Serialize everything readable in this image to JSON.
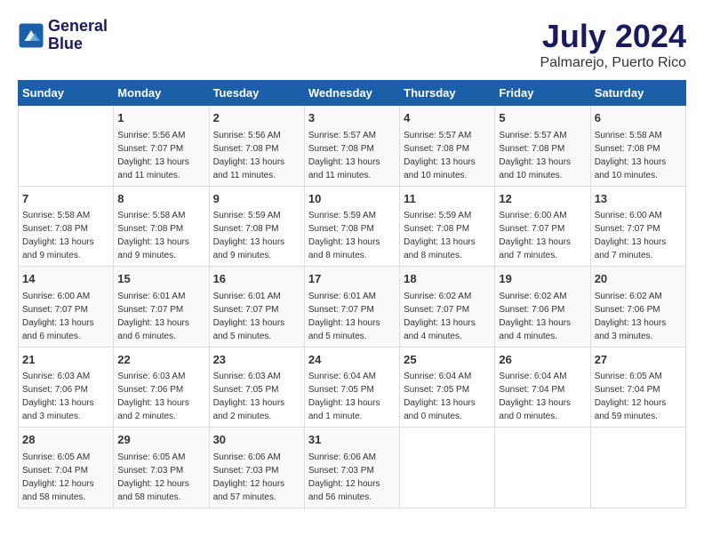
{
  "header": {
    "logo_line1": "General",
    "logo_line2": "Blue",
    "title": "July 2024",
    "subtitle": "Palmarejo, Puerto Rico"
  },
  "days_of_week": [
    "Sunday",
    "Monday",
    "Tuesday",
    "Wednesday",
    "Thursday",
    "Friday",
    "Saturday"
  ],
  "weeks": [
    [
      {
        "day": "",
        "info": ""
      },
      {
        "day": "1",
        "info": "Sunrise: 5:56 AM\nSunset: 7:07 PM\nDaylight: 13 hours\nand 11 minutes."
      },
      {
        "day": "2",
        "info": "Sunrise: 5:56 AM\nSunset: 7:08 PM\nDaylight: 13 hours\nand 11 minutes."
      },
      {
        "day": "3",
        "info": "Sunrise: 5:57 AM\nSunset: 7:08 PM\nDaylight: 13 hours\nand 11 minutes."
      },
      {
        "day": "4",
        "info": "Sunrise: 5:57 AM\nSunset: 7:08 PM\nDaylight: 13 hours\nand 10 minutes."
      },
      {
        "day": "5",
        "info": "Sunrise: 5:57 AM\nSunset: 7:08 PM\nDaylight: 13 hours\nand 10 minutes."
      },
      {
        "day": "6",
        "info": "Sunrise: 5:58 AM\nSunset: 7:08 PM\nDaylight: 13 hours\nand 10 minutes."
      }
    ],
    [
      {
        "day": "7",
        "info": "Sunrise: 5:58 AM\nSunset: 7:08 PM\nDaylight: 13 hours\nand 9 minutes."
      },
      {
        "day": "8",
        "info": "Sunrise: 5:58 AM\nSunset: 7:08 PM\nDaylight: 13 hours\nand 9 minutes."
      },
      {
        "day": "9",
        "info": "Sunrise: 5:59 AM\nSunset: 7:08 PM\nDaylight: 13 hours\nand 9 minutes."
      },
      {
        "day": "10",
        "info": "Sunrise: 5:59 AM\nSunset: 7:08 PM\nDaylight: 13 hours\nand 8 minutes."
      },
      {
        "day": "11",
        "info": "Sunrise: 5:59 AM\nSunset: 7:08 PM\nDaylight: 13 hours\nand 8 minutes."
      },
      {
        "day": "12",
        "info": "Sunrise: 6:00 AM\nSunset: 7:07 PM\nDaylight: 13 hours\nand 7 minutes."
      },
      {
        "day": "13",
        "info": "Sunrise: 6:00 AM\nSunset: 7:07 PM\nDaylight: 13 hours\nand 7 minutes."
      }
    ],
    [
      {
        "day": "14",
        "info": "Sunrise: 6:00 AM\nSunset: 7:07 PM\nDaylight: 13 hours\nand 6 minutes."
      },
      {
        "day": "15",
        "info": "Sunrise: 6:01 AM\nSunset: 7:07 PM\nDaylight: 13 hours\nand 6 minutes."
      },
      {
        "day": "16",
        "info": "Sunrise: 6:01 AM\nSunset: 7:07 PM\nDaylight: 13 hours\nand 5 minutes."
      },
      {
        "day": "17",
        "info": "Sunrise: 6:01 AM\nSunset: 7:07 PM\nDaylight: 13 hours\nand 5 minutes."
      },
      {
        "day": "18",
        "info": "Sunrise: 6:02 AM\nSunset: 7:07 PM\nDaylight: 13 hours\nand 4 minutes."
      },
      {
        "day": "19",
        "info": "Sunrise: 6:02 AM\nSunset: 7:06 PM\nDaylight: 13 hours\nand 4 minutes."
      },
      {
        "day": "20",
        "info": "Sunrise: 6:02 AM\nSunset: 7:06 PM\nDaylight: 13 hours\nand 3 minutes."
      }
    ],
    [
      {
        "day": "21",
        "info": "Sunrise: 6:03 AM\nSunset: 7:06 PM\nDaylight: 13 hours\nand 3 minutes."
      },
      {
        "day": "22",
        "info": "Sunrise: 6:03 AM\nSunset: 7:06 PM\nDaylight: 13 hours\nand 2 minutes."
      },
      {
        "day": "23",
        "info": "Sunrise: 6:03 AM\nSunset: 7:05 PM\nDaylight: 13 hours\nand 2 minutes."
      },
      {
        "day": "24",
        "info": "Sunrise: 6:04 AM\nSunset: 7:05 PM\nDaylight: 13 hours\nand 1 minute."
      },
      {
        "day": "25",
        "info": "Sunrise: 6:04 AM\nSunset: 7:05 PM\nDaylight: 13 hours\nand 0 minutes."
      },
      {
        "day": "26",
        "info": "Sunrise: 6:04 AM\nSunset: 7:04 PM\nDaylight: 13 hours\nand 0 minutes."
      },
      {
        "day": "27",
        "info": "Sunrise: 6:05 AM\nSunset: 7:04 PM\nDaylight: 12 hours\nand 59 minutes."
      }
    ],
    [
      {
        "day": "28",
        "info": "Sunrise: 6:05 AM\nSunset: 7:04 PM\nDaylight: 12 hours\nand 58 minutes."
      },
      {
        "day": "29",
        "info": "Sunrise: 6:05 AM\nSunset: 7:03 PM\nDaylight: 12 hours\nand 58 minutes."
      },
      {
        "day": "30",
        "info": "Sunrise: 6:06 AM\nSunset: 7:03 PM\nDaylight: 12 hours\nand 57 minutes."
      },
      {
        "day": "31",
        "info": "Sunrise: 6:06 AM\nSunset: 7:03 PM\nDaylight: 12 hours\nand 56 minutes."
      },
      {
        "day": "",
        "info": ""
      },
      {
        "day": "",
        "info": ""
      },
      {
        "day": "",
        "info": ""
      }
    ]
  ]
}
